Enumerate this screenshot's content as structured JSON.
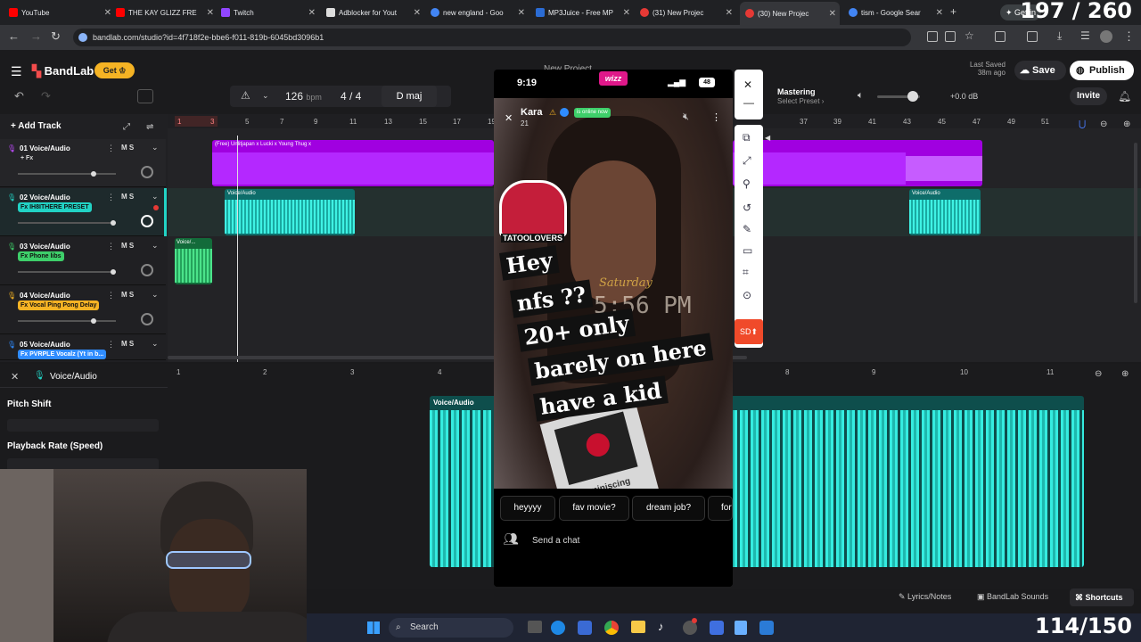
{
  "browser": {
    "tabs": [
      {
        "label": "YouTube",
        "color": "#ff0000"
      },
      {
        "label": "THE KAY GLIZZ FRE",
        "color": "#ff0000"
      },
      {
        "label": "Twitch",
        "color": "#9146ff"
      },
      {
        "label": "Adblocker for Yout",
        "color": "#dddddd"
      },
      {
        "label": "new england - Goo",
        "color": "#4285f4"
      },
      {
        "label": "MP3Juice - Free MP",
        "color": "#2b6cd4"
      },
      {
        "label": "(31) New Projec",
        "color": "#e53935"
      },
      {
        "label": "(30) New Projec",
        "color": "#e53935"
      },
      {
        "label": "tism - Google Sear",
        "color": "#4285f4"
      }
    ],
    "get_label": "Get in",
    "url": "bandlab.com/studio?id=4f718f2e-bbe6-f011-819b-6045bd3096b1"
  },
  "overlay_counters": {
    "top": "197 / 260",
    "bottom": "114/150"
  },
  "header": {
    "brand": "BandLab",
    "get_button": "Get",
    "project_title": "New Project",
    "last_saved_label": "Last Saved",
    "last_saved_time": "38m ago",
    "save_label": "Save",
    "publish_label": "Publish",
    "mastering_label": "Mastering",
    "mastering_preset": "Select Preset",
    "volume_db": "+0.0 dB",
    "invite_label": "Invite"
  },
  "transport": {
    "bpm": "126",
    "bpm_unit": "bpm",
    "time_signature": "4 / 4",
    "key": "D maj"
  },
  "track_panel": {
    "add_track": "Add Track",
    "tracks": [
      {
        "name": "01  Voice/Audio",
        "fx": "+ Fx",
        "fx_color": "#3a3a3e"
      },
      {
        "name": "02  Voice/Audio",
        "fx": "Fx IH8ITHERE PRESET",
        "fx_color": "#22d3c5"
      },
      {
        "name": "03  Voice/Audio",
        "fx": "Fx Phone libs",
        "fx_color": "#3ecf6a"
      },
      {
        "name": "04  Voice/Audio",
        "fx": "Fx Vocal Ping Pong Delay",
        "fx_color": "#f5b324"
      },
      {
        "name": "05  Voice/Audio",
        "fx": "Fx PVRPLE Vocalz (Yt in b...",
        "fx_color": "#2f8cff"
      }
    ],
    "ms_labels": "M  S"
  },
  "ruler_top": [
    "1",
    "3",
    "5",
    "7",
    "9",
    "11",
    "13",
    "15",
    "17",
    "19",
    "37",
    "39",
    "41",
    "43",
    "45",
    "47",
    "49",
    "51"
  ],
  "clips": {
    "purple_title": "(Free) Unlitjapan x Lucki x Young Thug x",
    "voice_label": "Voice/Audio",
    "small_label": "Voice/..."
  },
  "editor": {
    "track_label": "Voice/Audio",
    "pitch_shift": "Pitch Shift",
    "playback_rate": "Playback Rate (Speed)",
    "ruler": [
      "1",
      "2",
      "3",
      "4",
      "8",
      "9",
      "10",
      "11"
    ],
    "clip_label": "Voice/Audio",
    "lyrics_notes": "Lyrics/Notes",
    "bandlab_sounds": "BandLab Sounds",
    "shortcuts": "Shortcuts"
  },
  "phone": {
    "time": "9:19",
    "app_logo": "wizz",
    "battery": "48",
    "user_name": "Kara",
    "user_sub": "21",
    "online_badge": "is online now",
    "sticker_text": "TATOOLOVERS",
    "overlay_day": "Saturday",
    "overlay_time": "5:56 PM",
    "captions": [
      "Hey",
      "nfs ??",
      "20+ only",
      "barely on here",
      "have a kid"
    ],
    "music_label": "Reminiscing",
    "chips": [
      "heyyyy",
      "fav movie?",
      "dream job?",
      "for"
    ],
    "chat_placeholder": "Send a chat",
    "sd_label": "SD"
  },
  "taskbar": {
    "search": "Search"
  }
}
